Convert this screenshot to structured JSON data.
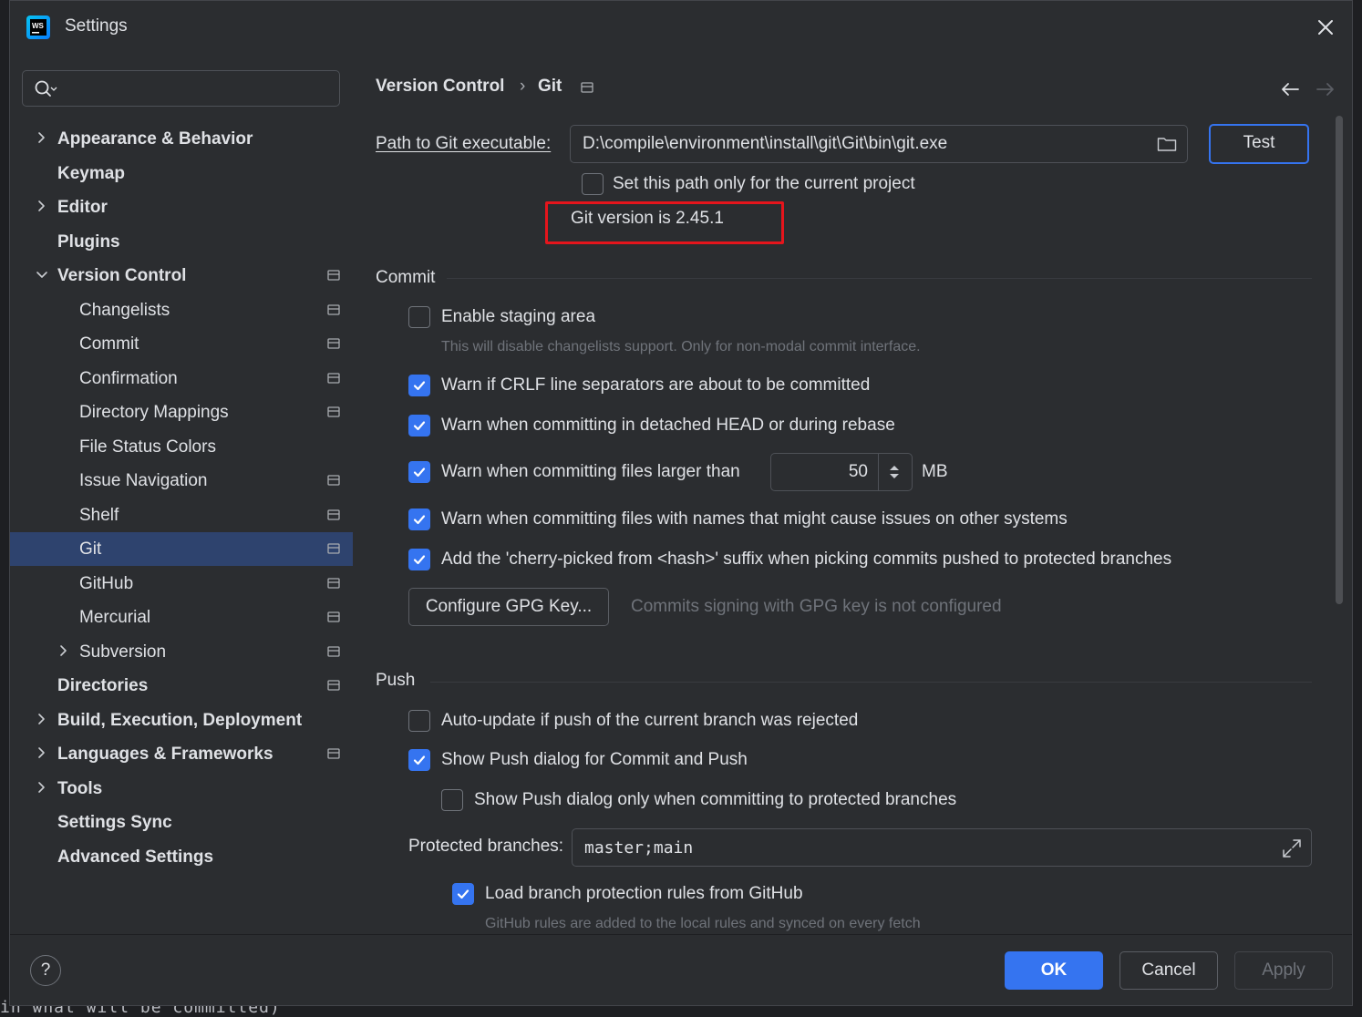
{
  "window": {
    "title": "Settings"
  },
  "search": {
    "placeholder": ""
  },
  "tree": [
    {
      "label": "Appearance & Behavior",
      "bold": true,
      "indent": 0,
      "chevron": "right",
      "project": false
    },
    {
      "label": "Keymap",
      "bold": true,
      "indent": 0,
      "chevron": "none",
      "project": false
    },
    {
      "label": "Editor",
      "bold": true,
      "indent": 0,
      "chevron": "right",
      "project": false
    },
    {
      "label": "Plugins",
      "bold": true,
      "indent": 0,
      "chevron": "none",
      "project": false
    },
    {
      "label": "Version Control",
      "bold": true,
      "indent": 0,
      "chevron": "down",
      "project": true
    },
    {
      "label": "Changelists",
      "bold": false,
      "indent": 1,
      "chevron": "none",
      "project": true
    },
    {
      "label": "Commit",
      "bold": false,
      "indent": 1,
      "chevron": "none",
      "project": true
    },
    {
      "label": "Confirmation",
      "bold": false,
      "indent": 1,
      "chevron": "none",
      "project": true
    },
    {
      "label": "Directory Mappings",
      "bold": false,
      "indent": 1,
      "chevron": "none",
      "project": true
    },
    {
      "label": "File Status Colors",
      "bold": false,
      "indent": 1,
      "chevron": "none",
      "project": false
    },
    {
      "label": "Issue Navigation",
      "bold": false,
      "indent": 1,
      "chevron": "none",
      "project": true
    },
    {
      "label": "Shelf",
      "bold": false,
      "indent": 1,
      "chevron": "none",
      "project": true
    },
    {
      "label": "Git",
      "bold": false,
      "indent": 1,
      "chevron": "none",
      "project": true,
      "selected": true
    },
    {
      "label": "GitHub",
      "bold": false,
      "indent": 1,
      "chevron": "none",
      "project": true
    },
    {
      "label": "Mercurial",
      "bold": false,
      "indent": 1,
      "chevron": "none",
      "project": true
    },
    {
      "label": "Subversion",
      "bold": false,
      "indent": 1,
      "chevron": "right",
      "project": true
    },
    {
      "label": "Directories",
      "bold": true,
      "indent": 0,
      "chevron": "none",
      "project": true
    },
    {
      "label": "Build, Execution, Deployment",
      "bold": true,
      "indent": 0,
      "chevron": "right",
      "project": false
    },
    {
      "label": "Languages & Frameworks",
      "bold": true,
      "indent": 0,
      "chevron": "right",
      "project": true
    },
    {
      "label": "Tools",
      "bold": true,
      "indent": 0,
      "chevron": "right",
      "project": false
    },
    {
      "label": "Settings Sync",
      "bold": true,
      "indent": 0,
      "chevron": "none",
      "project": false
    },
    {
      "label": "Advanced Settings",
      "bold": true,
      "indent": 0,
      "chevron": "none",
      "project": false
    }
  ],
  "breadcrumb": {
    "parent": "Version Control",
    "separator": "›",
    "current": "Git"
  },
  "git": {
    "path_label": "Path to Git executable:",
    "path_value": "D:\\compile\\environment\\install\\git\\Git\\bin\\git.exe",
    "test_label": "Test",
    "current_project_label": "Set this path only for the current project",
    "version_text": "Git version is 2.45.1"
  },
  "commit": {
    "header": "Commit",
    "staging_label": "Enable staging area",
    "staging_hint": "This will disable changelists support. Only for non-modal commit interface.",
    "crlf_label": "Warn if CRLF line separators are about to be committed",
    "detached_label": "Warn when committing in detached HEAD or during rebase",
    "larger_label": "Warn when committing files larger than",
    "larger_value": "50",
    "larger_unit": "MB",
    "names_label": "Warn when committing files with names that might cause issues on other systems",
    "cherry_label": "Add the 'cherry-picked from <hash>' suffix when picking commits pushed to protected branches",
    "gpg_button": "Configure GPG Key...",
    "gpg_hint": "Commits signing with GPG key is not configured"
  },
  "push": {
    "header": "Push",
    "autoupdate_label": "Auto-update if push of the current branch was rejected",
    "show_dialog_label": "Show Push dialog for Commit and Push",
    "protected_only_label": "Show Push dialog only when committing to protected branches",
    "protected_label": "Protected branches:",
    "protected_value": "master;main",
    "github_rules_label": "Load branch protection rules from GitHub",
    "github_rules_hint": "GitHub rules are added to the local rules and synced on every fetch"
  },
  "checkbox_states": {
    "current_project": false,
    "staging": false,
    "crlf": true,
    "detached": true,
    "larger": true,
    "names": true,
    "cherry": true,
    "autoupdate": false,
    "show_dialog": true,
    "protected_only": false,
    "github_rules": true
  },
  "footer": {
    "ok": "OK",
    "cancel": "Cancel",
    "apply": "Apply",
    "help": "?"
  },
  "background": {
    "editor_text": "in what will be committed)"
  },
  "colors": {
    "accent": "#3574f0",
    "selection": "#2e436e",
    "highlight_box": "#e5151c"
  }
}
